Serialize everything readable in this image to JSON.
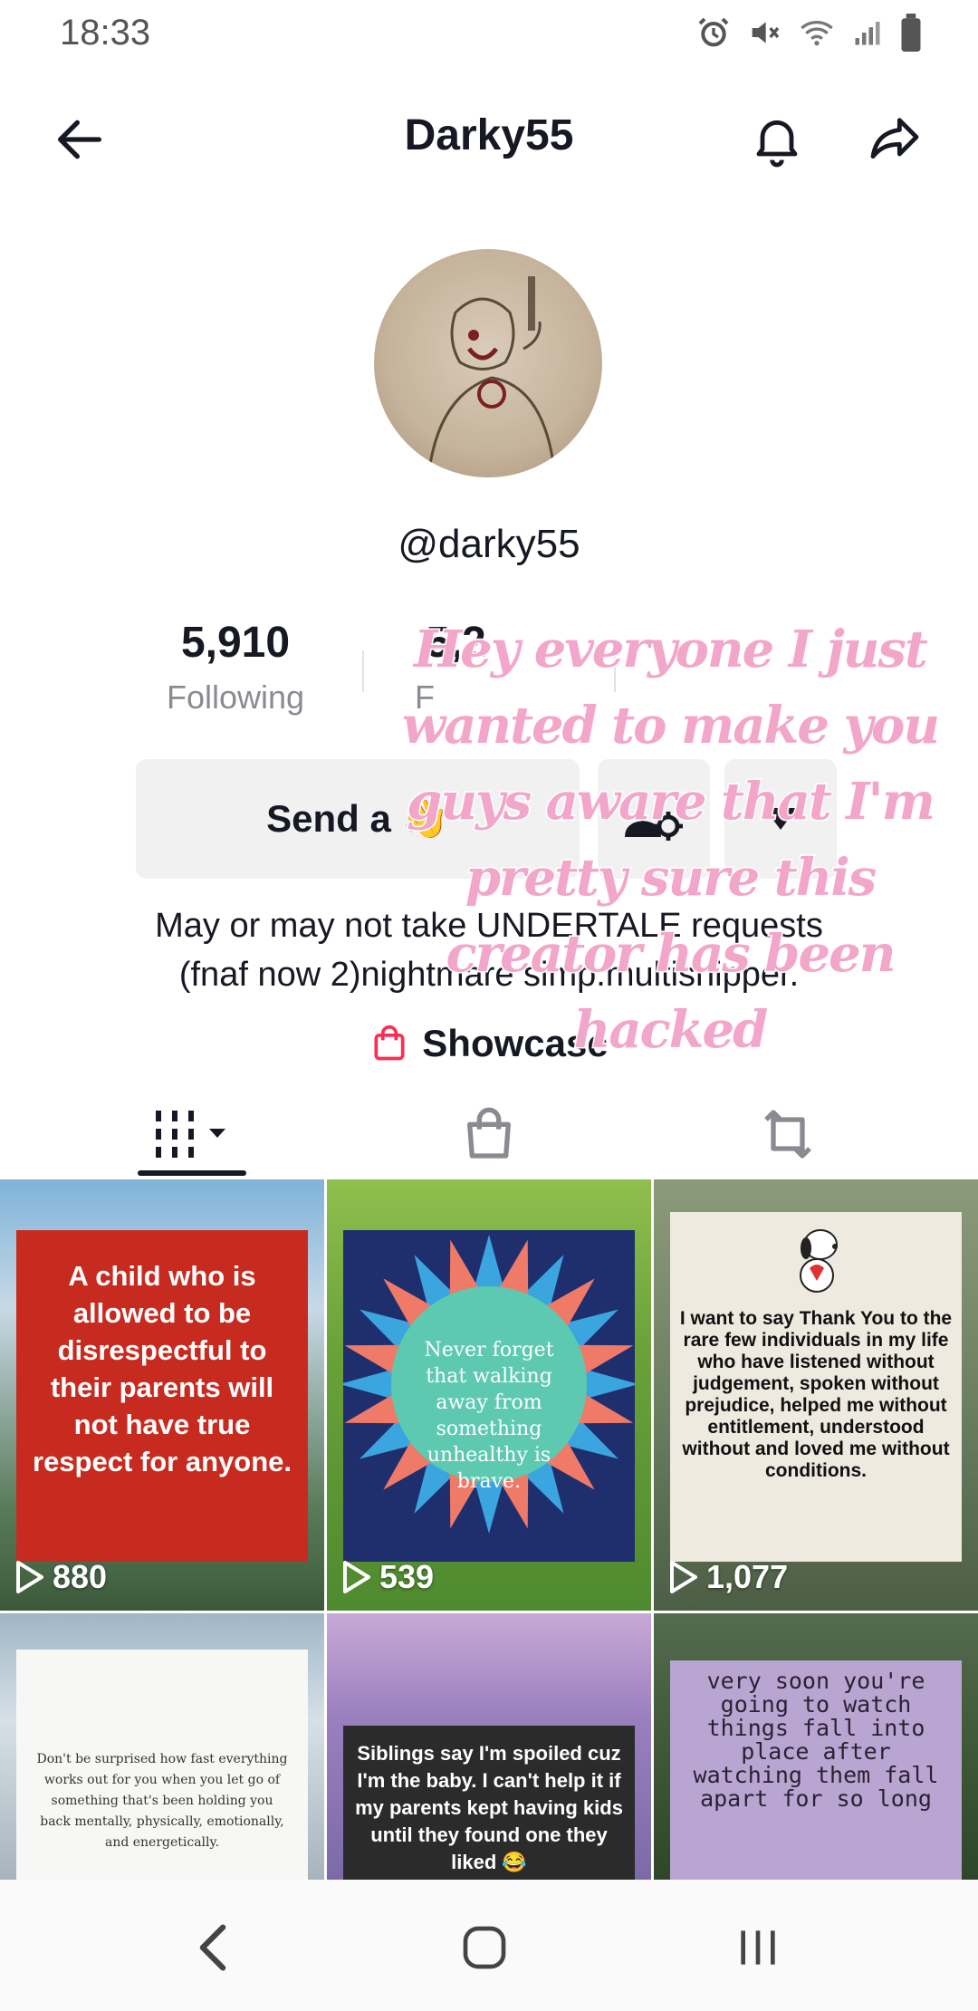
{
  "status_bar": {
    "time": "18:33"
  },
  "header": {
    "title": "Darky55"
  },
  "profile": {
    "handle": "@darky55",
    "stats": [
      {
        "value": "5,910",
        "label": "Following"
      },
      {
        "value": "5,2",
        "label": "F"
      },
      {
        "value": "",
        "label": ""
      }
    ],
    "send_button": "Send a 👋",
    "bio_line1": "May or may not take UNDERTALE requests",
    "bio_line2": "(fnaf now 2)nightmare simp.multishipper.",
    "showcase": "Showcase"
  },
  "overlay_text": "Hey everyone I just wanted to make you guys aware that I'm pretty sure this creator has been hacked",
  "videos": [
    {
      "text": "A child who is allowed to be disrespectful to their parents will not have true respect for anyone.",
      "views": "880"
    },
    {
      "text": "Never forget that walking away from something unhealthy is brave.",
      "views": "539"
    },
    {
      "text": "I want to say Thank You to the rare few individuals in my life who have listened without judgement, spoken without prejudice, helped me without entitlement, understood without and loved me without conditions.",
      "views": "1,077"
    },
    {
      "text": "Don't be surprised how fast everything works out for you when you let go of something that's been holding you back mentally, physically, emotionally, and energetically.",
      "views": ""
    },
    {
      "text": "Siblings say I'm spoiled cuz I'm the baby. I can't help it if my parents kept having kids until they found one they liked 😂",
      "views": ""
    },
    {
      "text": "very soon you're going to watch things fall into place after watching them fall apart for so long",
      "views": ""
    }
  ],
  "colors": {
    "accent": "#fe2c55",
    "text": "#161823",
    "overlay": "#f2a6c9"
  }
}
